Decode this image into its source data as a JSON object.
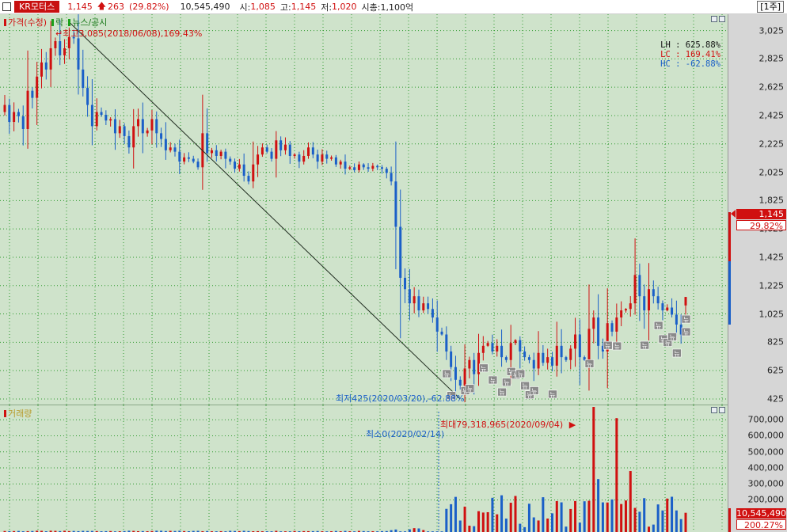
{
  "topbar": {
    "stock_name": "KR모터스",
    "price": "1,145",
    "change": "263",
    "change_pct": "(29.82%)",
    "volume": "10,545,490",
    "open_label": "시:",
    "open": "1,085",
    "high_label": "고:",
    "high": "1,145",
    "low_label": "저:",
    "low": "1,020",
    "cap_label": "시총:",
    "cap": "1,100억",
    "period": "[1주]"
  },
  "price_panel": {
    "legend": [
      {
        "label": "가격(수정)",
        "color": "#d01010"
      },
      {
        "label": "락",
        "color": "#1aa01a"
      },
      {
        "label": "뉴스/공시",
        "color": "#1aa01a"
      }
    ],
    "stats": [
      {
        "text": "LH : 625.88%",
        "color": "#111111"
      },
      {
        "text": "LC : 169.41%",
        "color": "#d01010"
      },
      {
        "text": "HC : -62.88%",
        "color": "#1a5fc8"
      }
    ],
    "high_annotation": "최고3,085(2018/06/08),169.43%",
    "low_annotation": "최저425(2020/03/20),-62.88%",
    "news_glyph": "뉴",
    "y_ticks": [
      "3,025",
      "2,825",
      "2,625",
      "2,425",
      "2,225",
      "2,025",
      "1,825",
      "1,625",
      "1,425",
      "1,225",
      "1,025",
      "825",
      "625",
      "425"
    ],
    "current_price_tag": "1,145",
    "current_pct_tag": "29.82%"
  },
  "volume_panel": {
    "legend": "거래량",
    "max_annotation": "최대79,318,965(2020/09/04)",
    "min_annotation": "최소0(2020/02/14)",
    "y_ticks": [
      "700,000",
      "600,000",
      "500,000",
      "400,000",
      "300,000",
      "200,000"
    ],
    "current_volume_tag": "10,545,490",
    "current_pct_tag": "200.27%"
  },
  "colors": {
    "up": "#d01010",
    "down": "#1a5fc8",
    "grid": "#2e9a2e",
    "plot_bg": "#cfe3cb",
    "axis_bg": "#d6d6d6"
  },
  "chart_data": {
    "type": "candlestick",
    "title": "",
    "ylim": [
      380,
      3140
    ],
    "y_ticks": [
      3025,
      2825,
      2625,
      2425,
      2225,
      2025,
      1825,
      1625,
      1425,
      1225,
      1025,
      825,
      625,
      425
    ],
    "high": {
      "value": 3085,
      "date": "2018/06/08",
      "pct": 169.43
    },
    "low": {
      "value": 425,
      "date": "2020/03/20",
      "pct": -62.88
    },
    "last": {
      "close": 1145,
      "open": 1085,
      "high": 1145,
      "low": 1020,
      "change": 263,
      "change_pct": 29.82
    },
    "closes": [
      2500,
      2380,
      2450,
      2420,
      2330,
      2600,
      2550,
      2700,
      2800,
      2750,
      2900,
      2950,
      2850,
      2900,
      2980,
      2970,
      2750,
      2620,
      2500,
      2350,
      2450,
      2430,
      2390,
      2400,
      2300,
      2350,
      2280,
      2200,
      2350,
      2400,
      2300,
      2320,
      2400,
      2300,
      2260,
      2180,
      2200,
      2170,
      2100,
      2130,
      2120,
      2100,
      2060,
      2300,
      2160,
      2180,
      2140,
      2170,
      2120,
      2100,
      2050,
      2080,
      2000,
      1960,
      2080,
      2150,
      2200,
      2170,
      2120,
      2250,
      2180,
      2220,
      2140,
      2150,
      2100,
      2140,
      2200,
      2150,
      2100,
      2150,
      2120,
      2130,
      2080,
      2100,
      2050,
      2060,
      2040,
      2080,
      2060,
      2050,
      2070,
      2060,
      2050,
      2020,
      1960,
      1640,
      1280,
      1200,
      1100,
      1150,
      1050,
      1100,
      1060,
      1000,
      900,
      880,
      760,
      650,
      560,
      520,
      640,
      700,
      600,
      750,
      800,
      820,
      760,
      800,
      720,
      700,
      820,
      840,
      760,
      720,
      700,
      640,
      750,
      680,
      720,
      660,
      800,
      720,
      700,
      780,
      880,
      720,
      700,
      920,
      1000,
      800,
      760,
      960,
      900,
      1000,
      1050,
      1060,
      1100,
      1300,
      1150,
      1050,
      1200,
      1150,
      1100,
      1050,
      1070,
      1020,
      950,
      880,
      1145
    ],
    "volume_ylim": [
      0,
      790000
    ],
    "volume_y_ticks": [
      700000,
      600000,
      500000,
      400000,
      300000,
      200000
    ],
    "volume_max": {
      "value": 79318965,
      "date": "2020/09/04"
    },
    "volume_min": {
      "value": 0,
      "date": "2020/02/14"
    },
    "last_volume": 10545490,
    "last_volume_pct": 200.27
  }
}
